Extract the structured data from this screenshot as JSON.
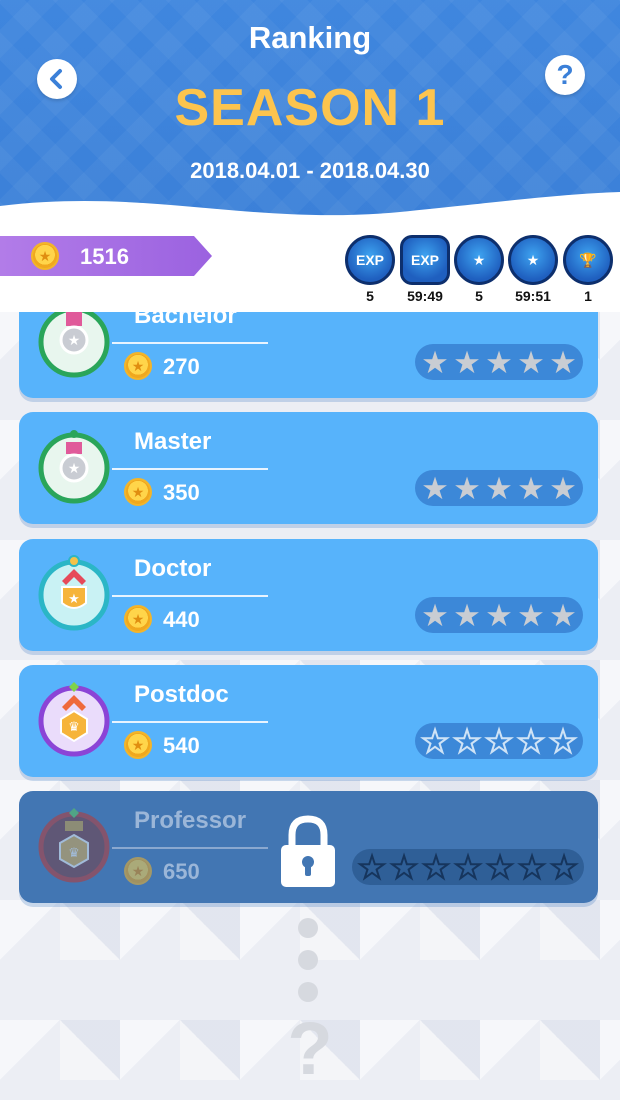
{
  "header": {
    "title": "Ranking",
    "season": "SEASON 1",
    "dates": "2018.04.01 - 2018.04.30",
    "help_label": "?"
  },
  "status": {
    "coins": "1516",
    "boosts": [
      {
        "icon": "exp-boost-icon",
        "label": "EXP",
        "value": "5"
      },
      {
        "icon": "exp-timer-icon",
        "label": "EXP",
        "value": "59:49"
      },
      {
        "icon": "star-plus-icon",
        "label": "★",
        "value": "5"
      },
      {
        "icon": "star-timer-icon",
        "label": "★",
        "value": "59:51"
      },
      {
        "icon": "trophy-icon",
        "label": "🏆",
        "value": "1"
      }
    ]
  },
  "ranks": [
    {
      "name": "Bachelor",
      "cost": "270",
      "stars_filled": 5,
      "stars_total": 5,
      "locked": false
    },
    {
      "name": "Master",
      "cost": "350",
      "stars_filled": 5,
      "stars_total": 5,
      "locked": false
    },
    {
      "name": "Doctor",
      "cost": "440",
      "stars_filled": 5,
      "stars_total": 5,
      "locked": false
    },
    {
      "name": "Postdoc",
      "cost": "540",
      "stars_filled": 0,
      "stars_total": 5,
      "locked": false
    },
    {
      "name": "Professor",
      "cost": "650",
      "stars_filled": 0,
      "stars_total": 7,
      "locked": true
    }
  ],
  "footer": {
    "mystery_label": "?"
  },
  "colors": {
    "header_blue": "#3f86de",
    "season_gold": "#fcc44e",
    "card_blue": "#57b3fb",
    "card_locked": "#4276b3",
    "banner_purple": "#a56fe4"
  }
}
